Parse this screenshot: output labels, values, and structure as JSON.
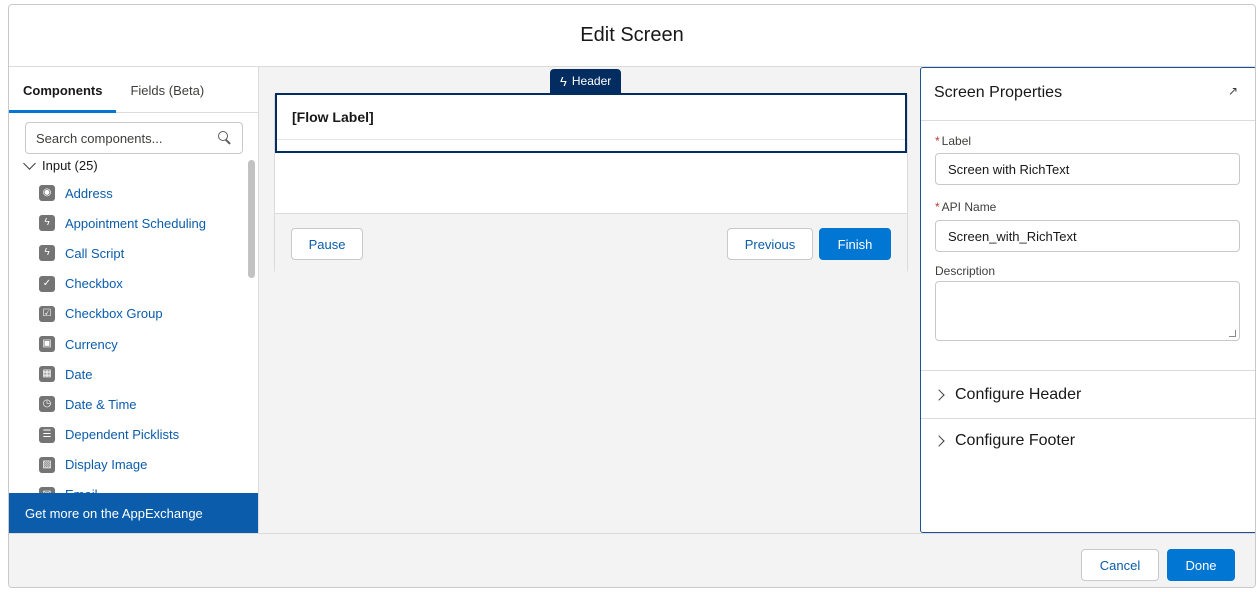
{
  "modal": {
    "title": "Edit Screen"
  },
  "left_panel": {
    "tabs": [
      {
        "label": "Components",
        "active": true
      },
      {
        "label": "Fields (Beta)",
        "active": false
      }
    ],
    "search_placeholder": "Search components...",
    "group_label": "Input (25)",
    "components": [
      {
        "label": "Address",
        "icon": "location-pin-icon",
        "glyph": "◉"
      },
      {
        "label": "Appointment Scheduling",
        "icon": "bolt-icon",
        "glyph": "ϟ"
      },
      {
        "label": "Call Script",
        "icon": "bolt-icon",
        "glyph": "ϟ"
      },
      {
        "label": "Checkbox",
        "icon": "checkbox-icon",
        "glyph": "✓"
      },
      {
        "label": "Checkbox Group",
        "icon": "checkbox-group-icon",
        "glyph": "☑"
      },
      {
        "label": "Currency",
        "icon": "currency-icon",
        "glyph": "▣"
      },
      {
        "label": "Date",
        "icon": "calendar-icon",
        "glyph": "▦"
      },
      {
        "label": "Date & Time",
        "icon": "datetime-icon",
        "glyph": "◷"
      },
      {
        "label": "Dependent Picklists",
        "icon": "picklist-icon",
        "glyph": "☰"
      },
      {
        "label": "Display Image",
        "icon": "image-icon",
        "glyph": "▨"
      },
      {
        "label": "Email",
        "icon": "email-icon",
        "glyph": "✉"
      }
    ],
    "appexchange_label": "Get more on the AppExchange"
  },
  "canvas": {
    "header_tag": "Header",
    "flow_label": "[Flow Label]",
    "buttons": {
      "pause": "Pause",
      "previous": "Previous",
      "finish": "Finish"
    }
  },
  "properties": {
    "title": "Screen Properties",
    "label_field": {
      "label": "Label",
      "value": "Screen with RichText"
    },
    "api_name_field": {
      "label": "API Name",
      "value": "Screen_with_RichText"
    },
    "description_field": {
      "label": "Description",
      "value": ""
    },
    "sections": [
      "Configure Header",
      "Configure Footer"
    ]
  },
  "footer": {
    "cancel": "Cancel",
    "done": "Done"
  },
  "colors": {
    "brand": "#0176d3",
    "link": "#0b5cab",
    "header_tag": "#032d60"
  }
}
